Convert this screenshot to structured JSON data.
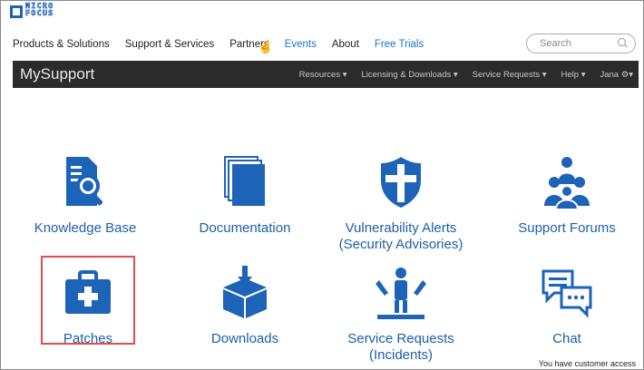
{
  "brand": {
    "logo_lines": [
      "MICRO",
      "FOCUS"
    ]
  },
  "topnav": {
    "items": [
      {
        "label": "Products & Solutions",
        "blue": false
      },
      {
        "label": "Support & Services",
        "blue": false
      },
      {
        "label": "Partners",
        "blue": false
      },
      {
        "label": "Events",
        "blue": true
      },
      {
        "label": "About",
        "blue": false
      },
      {
        "label": "Free Trials",
        "blue": true
      }
    ]
  },
  "search": {
    "placeholder": "Search"
  },
  "mysupport_bar": {
    "title": "MySupport",
    "menu": [
      "Resources ▾",
      "Licensing & Downloads ▾",
      "Service Requests ▾",
      "Help ▾",
      "Jana ⚙▾"
    ]
  },
  "tiles": [
    {
      "label": "Knowledge Base",
      "icon": "knowledge-base-icon"
    },
    {
      "label": "Documentation",
      "icon": "documentation-icon"
    },
    {
      "label": "Vulnerability Alerts\n(Security Advisories)",
      "icon": "shield-icon"
    },
    {
      "label": "Support Forums",
      "icon": "forums-icon"
    },
    {
      "label": "Patches",
      "icon": "medical-kit-icon"
    },
    {
      "label": "Downloads",
      "icon": "download-box-icon"
    },
    {
      "label": "Service Requests\n(Incidents)",
      "icon": "service-icon"
    },
    {
      "label": "Chat",
      "icon": "chat-icon"
    }
  ],
  "footer": {
    "access_text": "You have customer access"
  },
  "colors": {
    "accent": "#1d63b8",
    "link": "#1d5fa8",
    "bar": "#2b2b2b",
    "highlight": "#e54b4b"
  }
}
